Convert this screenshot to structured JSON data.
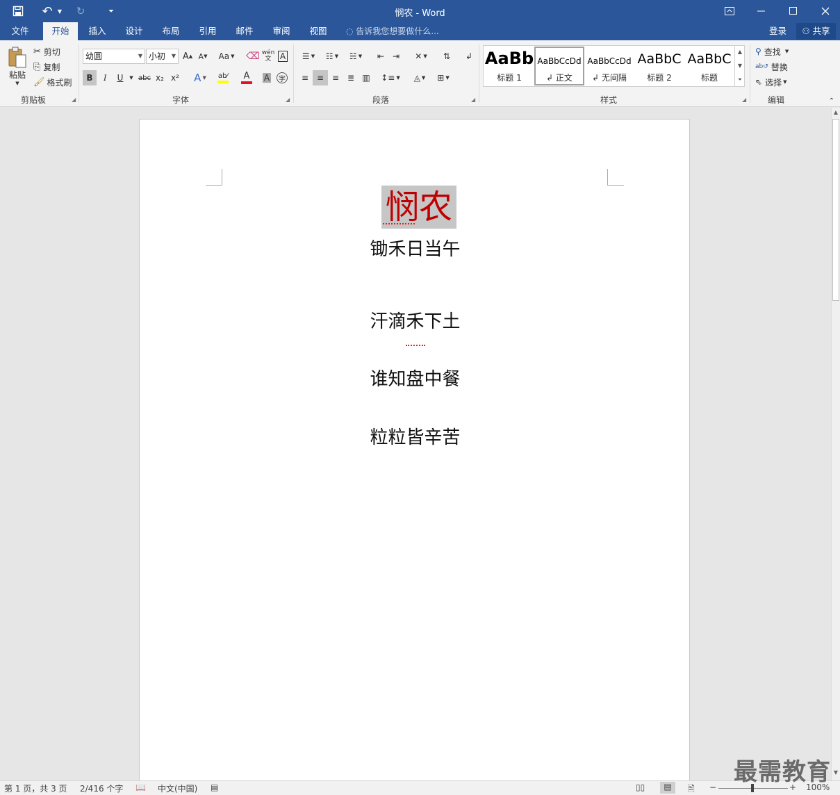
{
  "window": {
    "title": "悯农 - Word",
    "qat": {
      "save_icon": "floppy-disk-icon",
      "undo_glyph": "↶",
      "redo_glyph": "↻",
      "customize_glyph": "⏷"
    }
  },
  "tabs": [
    {
      "label": "文件"
    },
    {
      "label": "开始"
    },
    {
      "label": "插入"
    },
    {
      "label": "设计"
    },
    {
      "label": "布局"
    },
    {
      "label": "引用"
    },
    {
      "label": "邮件"
    },
    {
      "label": "审阅"
    },
    {
      "label": "视图"
    }
  ],
  "tellme": "告诉我您想要做什么...",
  "account": {
    "login": "登录",
    "share": "共享"
  },
  "clipboard": {
    "paste": "粘贴",
    "cut": "剪切",
    "copy": "复制",
    "format_painter": "格式刷",
    "group": "剪贴板"
  },
  "font": {
    "font_name": "幼圆",
    "font_size": "小初",
    "group": "字体",
    "bold": "B",
    "italic": "I",
    "underline": "U",
    "strike": "abc",
    "subscript": "x₂",
    "superscript": "x²",
    "grow": "A",
    "shrink": "A",
    "case": "Aa",
    "pinyin": "wén",
    "colors": {
      "highlight": "#ffff00",
      "font_color": "#e81123"
    }
  },
  "paragraph": {
    "group": "段落"
  },
  "styles": {
    "group": "样式",
    "items": [
      {
        "sample": "AaBb",
        "name": "标题 1"
      },
      {
        "sample": "AaBbCcDd",
        "name": "正文"
      },
      {
        "sample": "AaBbCcDd",
        "name": "无间隔"
      },
      {
        "sample": "AaBbC",
        "name": "标题 2"
      },
      {
        "sample": "AaBbC",
        "name": "标题"
      }
    ]
  },
  "editing": {
    "find": "查找",
    "replace": "替换",
    "select": "选择",
    "group": "编辑"
  },
  "document": {
    "title": "悯农",
    "lines": [
      "锄禾日当午",
      "汗滴禾下土",
      "谁知盘中餐",
      "粒粒皆辛苦"
    ],
    "title_color": "#c00000"
  },
  "status": {
    "page": "第 1 页，共 3 页",
    "words": "2/416 个字",
    "language": "中文(中国)",
    "zoom": "100%"
  },
  "watermark": "最需教育"
}
